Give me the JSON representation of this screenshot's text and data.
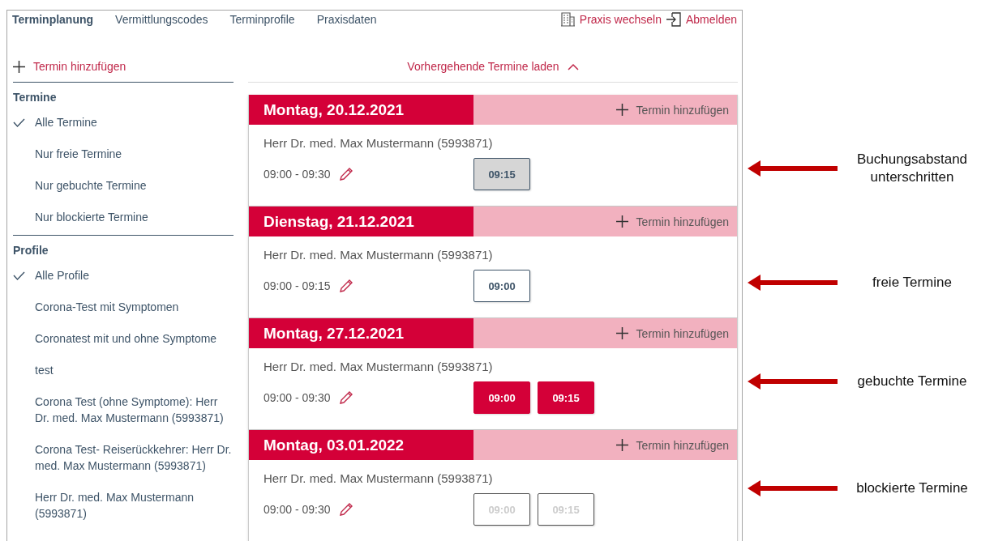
{
  "nav": {
    "tabs": [
      {
        "label": "Terminplanung",
        "selected": true
      },
      {
        "label": "Vermittlungscodes",
        "selected": false
      },
      {
        "label": "Terminprofile",
        "selected": false
      },
      {
        "label": "Praxisdaten",
        "selected": false
      }
    ],
    "switch_practice": "Praxis wechseln",
    "logout": "Abmelden"
  },
  "sidebar": {
    "add_label": "Termin hinzufügen",
    "sections": [
      {
        "title": "Termine",
        "items": [
          {
            "label": "Alle Termine",
            "selected": true
          },
          {
            "label": "Nur freie Termine",
            "selected": false
          },
          {
            "label": "Nur gebuchte Termine",
            "selected": false
          },
          {
            "label": "Nur blockierte Termine",
            "selected": false
          }
        ]
      },
      {
        "title": "Profile",
        "items": [
          {
            "label": "Alle Profile",
            "selected": true
          },
          {
            "label": "Corona-Test mit Symptomen",
            "selected": false
          },
          {
            "label": "Coronatest mit und ohne Symptome",
            "selected": false
          },
          {
            "label": "test",
            "selected": false
          },
          {
            "label": "Corona Test (ohne Symptome): Herr Dr. med. Max Mustermann (5993871)",
            "selected": false
          },
          {
            "label": "Corona Test- Reiserückkehrer: Herr Dr. med. Max Mustermann (5993871)",
            "selected": false
          },
          {
            "label": "Herr Dr. med. Max Mustermann (5993871)",
            "selected": false
          }
        ]
      }
    ]
  },
  "main": {
    "load_previous": "Vorhergehende Termine laden",
    "days": [
      {
        "date": "Montag, 20.12.2021",
        "add_label": "Termin hinzufügen",
        "doctor": "Herr Dr. med. Max Mustermann (5993871)",
        "time_range": "09:00 - 09:30",
        "slots": [
          {
            "time": "09:15",
            "kind": "too-close"
          }
        ]
      },
      {
        "date": "Dienstag, 21.12.2021",
        "add_label": "Termin hinzufügen",
        "doctor": "Herr Dr. med. Max Mustermann (5993871)",
        "time_range": "09:00 - 09:15",
        "slots": [
          {
            "time": "09:00",
            "kind": "free"
          }
        ]
      },
      {
        "date": "Montag, 27.12.2021",
        "add_label": "Termin hinzufügen",
        "doctor": "Herr Dr. med. Max Mustermann (5993871)",
        "time_range": "09:00 - 09:30",
        "slots": [
          {
            "time": "09:00",
            "kind": "booked"
          },
          {
            "time": "09:15",
            "kind": "booked"
          }
        ]
      },
      {
        "date": "Montag, 03.01.2022",
        "add_label": "Termin hinzufügen",
        "doctor": "Herr Dr. med. Max Mustermann (5993871)",
        "time_range": "09:00 - 09:30",
        "slots": [
          {
            "time": "09:00",
            "kind": "blocked"
          },
          {
            "time": "09:15",
            "kind": "blocked"
          }
        ]
      }
    ]
  },
  "annotations": [
    "Buchungsabstand unterschritten",
    "freie Termine",
    "gebuchte Termine",
    "blockierte Termine"
  ]
}
